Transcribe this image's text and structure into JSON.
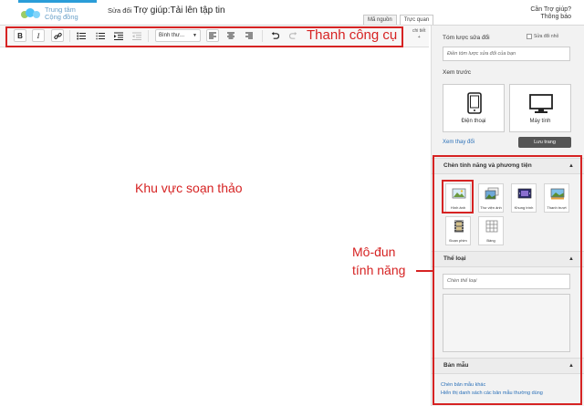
{
  "header": {
    "logo_line1": "Trung tâm",
    "logo_line2": "Cộng đồng",
    "edit_prefix": "Sửa đổi",
    "page_title": "Trợ giúp:Tải lên tập tin",
    "help_line1": "Cần Trợ giúp?",
    "help_line2": "Thông báo",
    "tab_source": "Mã nguồn",
    "tab_visual": "Trực quan"
  },
  "toolbar": {
    "bold": "B",
    "italic": "I",
    "format_select": "Bình thư...",
    "special_chars_line1": "chi tiết",
    "special_chars_line2": "+"
  },
  "sidebar": {
    "summary_label": "Tóm lược sửa đổi",
    "minor_edit_label": "Sửa đổi nhỏ",
    "summary_placeholder": "Điền tóm lược sửa đổi của bạn",
    "preview_label": "Xem trước",
    "device_phone": "Điện thoại",
    "device_desktop": "Máy tính",
    "view_changes": "Xem thay đổi",
    "save_button": "Lưu trang",
    "insert_section": "Chèn tính năng và phương tiện",
    "tools": [
      {
        "label": "Hình ảnh",
        "icon": "image-icon"
      },
      {
        "label": "Thư viện ảnh",
        "icon": "gallery-icon"
      },
      {
        "label": "Khung trình",
        "icon": "slideshow-icon"
      },
      {
        "label": "Thanh trượt",
        "icon": "slider-icon"
      },
      {
        "label": "Đoạn phim",
        "icon": "video-icon"
      },
      {
        "label": "Bảng",
        "icon": "table-icon"
      }
    ],
    "categories_section": "Thể loại",
    "category_placeholder": "Chèn thể loại",
    "templates_section": "Bản mẫu",
    "insert_other_template": "Chèn bản mẫu khác",
    "show_common_templates": "Hiển thị danh sách các bản mẫu thường dùng"
  },
  "annotations": {
    "toolbar_label": "Thanh công cụ",
    "editor_label": "Khu vực soạn thảo",
    "modules_line1": "Mô-đun",
    "modules_line2": "tính năng"
  },
  "colors": {
    "annotation_red": "#d62323",
    "link_blue": "#2a70b8",
    "accent_blue": "#2a9dd8"
  }
}
